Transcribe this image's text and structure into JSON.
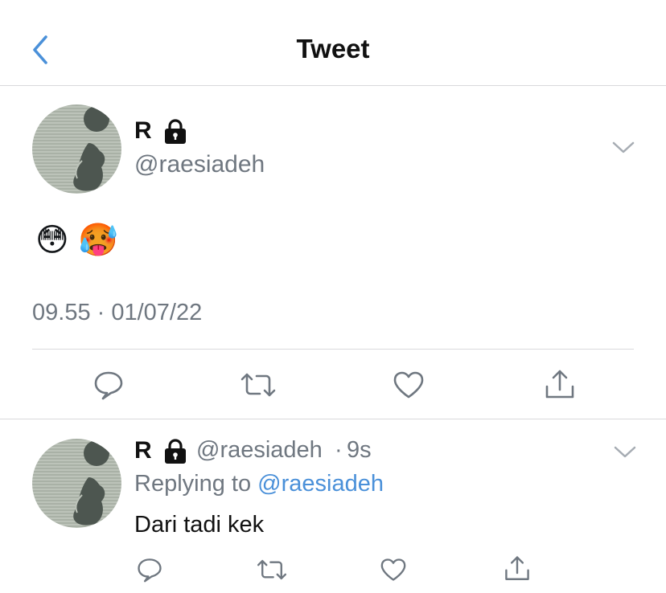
{
  "colors": {
    "accent": "#4a90d9",
    "muted": "#6f7780",
    "divider": "#d9d9dc"
  },
  "header": {
    "title": "Tweet",
    "back_icon": "chevron-left-icon"
  },
  "main_tweet": {
    "display_name": "R",
    "protected_icon": "lock-icon",
    "handle": "@raesiadeh",
    "menu_icon": "chevron-down-icon",
    "emojis": [
      "😳",
      "🥵"
    ],
    "timestamp": "09.55 · 01/07/22",
    "actions": [
      "reply-icon",
      "retweet-icon",
      "like-icon",
      "share-icon"
    ]
  },
  "reply_tweet": {
    "display_name": "R",
    "protected_icon": "lock-icon",
    "handle": "@raesiadeh",
    "separator": "·",
    "time_ago": "9s",
    "replying_to_label": "Replying to",
    "replying_to_handle": "@raesiadeh",
    "text": "Dari tadi kek",
    "menu_icon": "chevron-down-icon",
    "actions": [
      "reply-icon",
      "retweet-icon",
      "like-icon",
      "share-icon"
    ]
  }
}
